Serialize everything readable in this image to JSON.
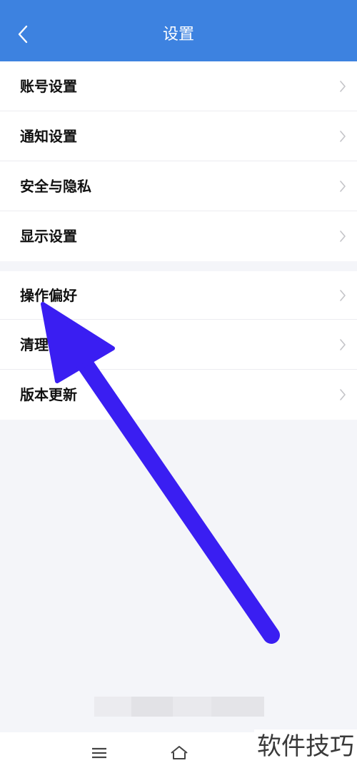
{
  "header": {
    "title": "设置",
    "back_icon": "chevron-left-icon",
    "background_color": "#3d82e0"
  },
  "settings_group_1": [
    {
      "label": "账号设置"
    },
    {
      "label": "通知设置"
    },
    {
      "label": "安全与隐私"
    },
    {
      "label": "显示设置"
    }
  ],
  "settings_group_2": [
    {
      "label": "操作偏好"
    },
    {
      "label": "清理"
    },
    {
      "label": "版本更新"
    }
  ],
  "annotation": {
    "type": "arrow",
    "color": "#3a1ef2",
    "points_to": "操作偏好"
  },
  "navbar": {
    "menu_icon": "menu-icon",
    "home_icon": "home-icon"
  },
  "watermark": {
    "text": "软件技巧"
  }
}
